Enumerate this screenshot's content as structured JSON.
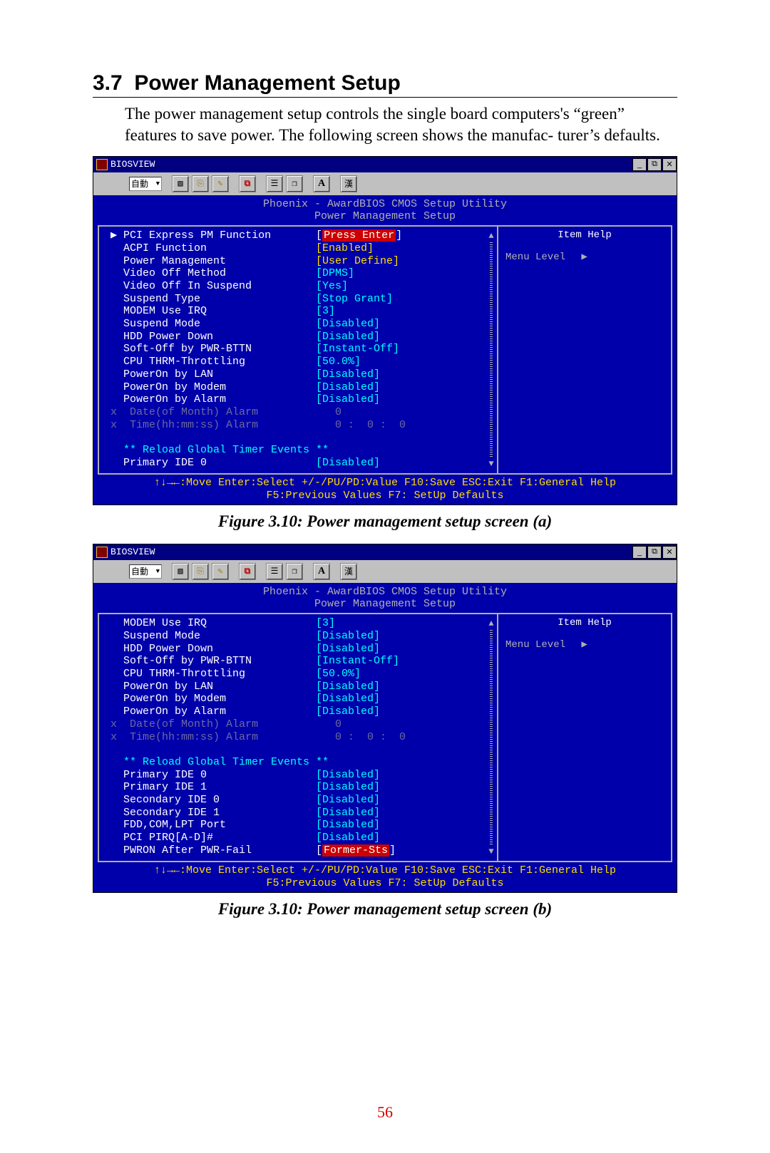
{
  "doc": {
    "section_number": "3.7",
    "section_title": "Power Management Setup",
    "paragraph": "The power management setup controls the single board computers's “green” features to save power. The following screen shows the manufac- turer’s defaults.",
    "caption_a": "Figure 3.10: Power management setup screen (a)",
    "caption_b": "Figure 3.10: Power management setup screen (b)",
    "page_number": "56"
  },
  "common": {
    "window_title": "BIOSVIEW",
    "titlebar_btn_min": "_",
    "titlebar_btn_max": "⧉",
    "titlebar_btn_close": "✕",
    "toolbar_select": "自動",
    "btn_marquee": "▧",
    "btn_copy": "⎘",
    "btn_paste": "✎",
    "btn_fullscreen": "⧉",
    "btn_prop": "☰",
    "btn_win": "❐",
    "btn_font": "A",
    "btn_cjk": "漢",
    "bios_title1": "Phoenix - AwardBIOS CMOS Setup Utility",
    "bios_title2": "Power Management Setup",
    "help_title": "Item Help",
    "help_menu_level": "Menu Level",
    "help_arrow": "▶",
    "scroll_up": "▲",
    "scroll_down": "▼",
    "footer1": "↑↓→←:Move   Enter:Select   +/-/PU/PD:Value   F10:Save   ESC:Exit   F1:General Help",
    "footer2": "F5:Previous Values                    F7: SetUp Defaults"
  },
  "screen_a": {
    "rows": [
      {
        "t": "item",
        "pointer": "▶",
        "label": "PCI Express PM Function",
        "value": "Press Enter",
        "vclass": "sel"
      },
      {
        "t": "item",
        "pointer": " ",
        "label": "ACPI Function",
        "value": "[Enabled]",
        "vclass": "yellow"
      },
      {
        "t": "item",
        "pointer": " ",
        "label": "Power Management",
        "value": "[User Define]",
        "vclass": "yellow"
      },
      {
        "t": "item",
        "pointer": " ",
        "label": "Video Off Method",
        "value": "[DPMS]",
        "vclass": "cyan"
      },
      {
        "t": "item",
        "pointer": " ",
        "label": "Video Off In Suspend",
        "value": "[Yes]",
        "vclass": "cyan"
      },
      {
        "t": "item",
        "pointer": " ",
        "label": "Suspend Type",
        "value": "[Stop Grant]",
        "vclass": "cyan"
      },
      {
        "t": "item",
        "pointer": " ",
        "label": "MODEM Use IRQ",
        "value": "[3]",
        "vclass": "cyan"
      },
      {
        "t": "item",
        "pointer": " ",
        "label": "Suspend Mode",
        "value": "[Disabled]",
        "vclass": "cyan"
      },
      {
        "t": "item",
        "pointer": " ",
        "label": "HDD Power Down",
        "value": "[Disabled]",
        "vclass": "cyan"
      },
      {
        "t": "item",
        "pointer": " ",
        "label": "Soft-Off by PWR-BTTN",
        "value": "[Instant-Off]",
        "vclass": "cyan"
      },
      {
        "t": "item",
        "pointer": " ",
        "label": "CPU THRM-Throttling",
        "value": "[50.0%]",
        "vclass": "cyan"
      },
      {
        "t": "item",
        "pointer": " ",
        "label": "PowerOn by LAN",
        "value": "[Disabled]",
        "vclass": "cyan"
      },
      {
        "t": "item",
        "pointer": " ",
        "label": "PowerOn by Modem",
        "value": "[Disabled]",
        "vclass": "cyan"
      },
      {
        "t": "item",
        "pointer": " ",
        "label": "PowerOn by Alarm",
        "value": "[Disabled]",
        "vclass": "cyan"
      },
      {
        "t": "disabled",
        "pointer": "x",
        "label": "Date(of Month) Alarm",
        "value": "  0",
        "vclass": "gray"
      },
      {
        "t": "disabled",
        "pointer": "x",
        "label": "Time(hh:mm:ss) Alarm",
        "value": "  0 :  0 :  0",
        "vclass": "gray"
      },
      {
        "t": "blank"
      },
      {
        "t": "heading",
        "label": "** Reload Global Timer Events **"
      },
      {
        "t": "item",
        "pointer": " ",
        "label": "Primary IDE 0",
        "value": "[Disabled]",
        "vclass": "cyan"
      }
    ]
  },
  "screen_b": {
    "rows": [
      {
        "t": "item",
        "pointer": " ",
        "label": "MODEM Use IRQ",
        "value": "[3]",
        "vclass": "cyan"
      },
      {
        "t": "item",
        "pointer": " ",
        "label": "Suspend Mode",
        "value": "[Disabled]",
        "vclass": "cyan"
      },
      {
        "t": "item",
        "pointer": " ",
        "label": "HDD Power Down",
        "value": "[Disabled]",
        "vclass": "cyan"
      },
      {
        "t": "item",
        "pointer": " ",
        "label": "Soft-Off by PWR-BTTN",
        "value": "[Instant-Off]",
        "vclass": "cyan"
      },
      {
        "t": "item",
        "pointer": " ",
        "label": "CPU THRM-Throttling",
        "value": "[50.0%]",
        "vclass": "cyan"
      },
      {
        "t": "item",
        "pointer": " ",
        "label": "PowerOn by LAN",
        "value": "[Disabled]",
        "vclass": "cyan"
      },
      {
        "t": "item",
        "pointer": " ",
        "label": "PowerOn by Modem",
        "value": "[Disabled]",
        "vclass": "cyan"
      },
      {
        "t": "item",
        "pointer": " ",
        "label": "PowerOn by Alarm",
        "value": "[Disabled]",
        "vclass": "cyan"
      },
      {
        "t": "disabled",
        "pointer": "x",
        "label": "Date(of Month) Alarm",
        "value": "  0",
        "vclass": "gray"
      },
      {
        "t": "disabled",
        "pointer": "x",
        "label": "Time(hh:mm:ss) Alarm",
        "value": "  0 :  0 :  0",
        "vclass": "gray"
      },
      {
        "t": "blank"
      },
      {
        "t": "heading",
        "label": "** Reload Global Timer Events **"
      },
      {
        "t": "item",
        "pointer": " ",
        "label": "Primary IDE 0",
        "value": "[Disabled]",
        "vclass": "cyan"
      },
      {
        "t": "item",
        "pointer": " ",
        "label": "Primary IDE 1",
        "value": "[Disabled]",
        "vclass": "cyan"
      },
      {
        "t": "item",
        "pointer": " ",
        "label": "Secondary IDE 0",
        "value": "[Disabled]",
        "vclass": "cyan"
      },
      {
        "t": "item",
        "pointer": " ",
        "label": "Secondary IDE 1",
        "value": "[Disabled]",
        "vclass": "cyan"
      },
      {
        "t": "item",
        "pointer": " ",
        "label": "FDD,COM,LPT Port",
        "value": "[Disabled]",
        "vclass": "cyan"
      },
      {
        "t": "item",
        "pointer": " ",
        "label": "PCI PIRQ[A-D]#",
        "value": "[Disabled]",
        "vclass": "cyan"
      },
      {
        "t": "item",
        "pointer": " ",
        "label": "PWRON After PWR-Fail",
        "value": "Former-Sts",
        "vclass": "sel"
      }
    ]
  }
}
